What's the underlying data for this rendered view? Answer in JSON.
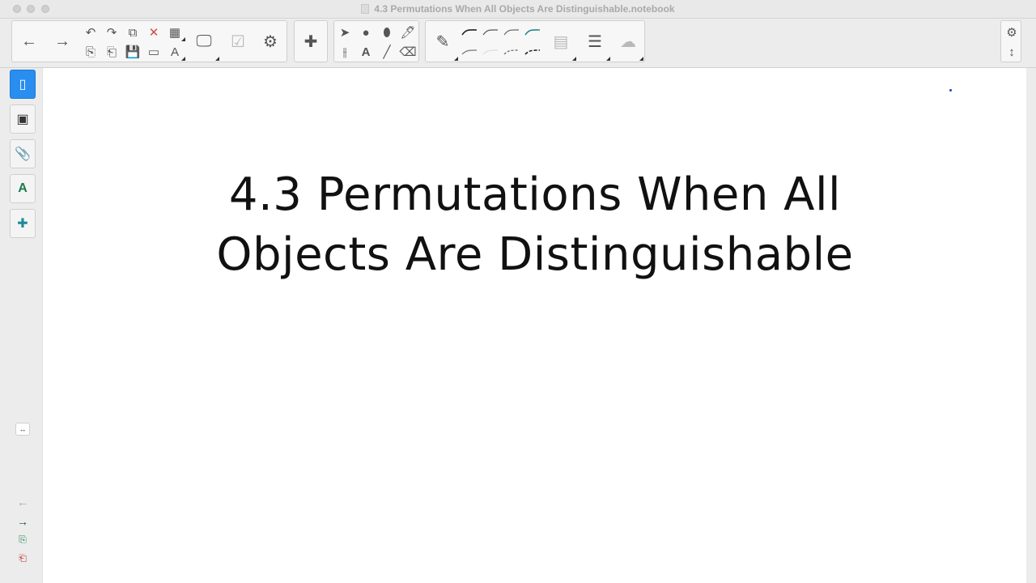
{
  "window": {
    "title": "4.3 Permutations When All Objects Are Distinguishable.notebook"
  },
  "toolbar": {
    "back": "←",
    "forward": "→",
    "undo": "↶",
    "redo": "↷",
    "paste": "⧉",
    "delete": "✕",
    "table": "▦",
    "import": "⎘",
    "export": "⎗",
    "save": "💾",
    "screen": "▭",
    "text_tool": "A",
    "display": "🖵",
    "check": "☑",
    "measure": "⚙",
    "addons": "✚",
    "select": "➤",
    "shapes": "●",
    "fill": "⬮",
    "pen_fill": "🖊",
    "measures": "⫲",
    "text": "A",
    "line": "╱",
    "eraser": "⌫",
    "pencil": "✎",
    "properties": "▤",
    "lines": "☰",
    "fill_cloud": "☁",
    "settings": "⚙",
    "expand": "↕"
  },
  "sidebar": {
    "tabs": [
      {
        "name": "page-sorter",
        "glyph": "▯"
      },
      {
        "name": "gallery",
        "glyph": "▣"
      },
      {
        "name": "attachments",
        "glyph": "📎"
      },
      {
        "name": "properties",
        "glyph": "A"
      },
      {
        "name": "addons",
        "glyph": "✚"
      }
    ],
    "collapse": "↔",
    "nav_prev": "←",
    "nav_next": "→",
    "nav_add": "⎘",
    "nav_delete": "⎗"
  },
  "canvas": {
    "title_line1": "4.3 Permutations When All",
    "title_line2": "Objects Are Distinguishable"
  }
}
